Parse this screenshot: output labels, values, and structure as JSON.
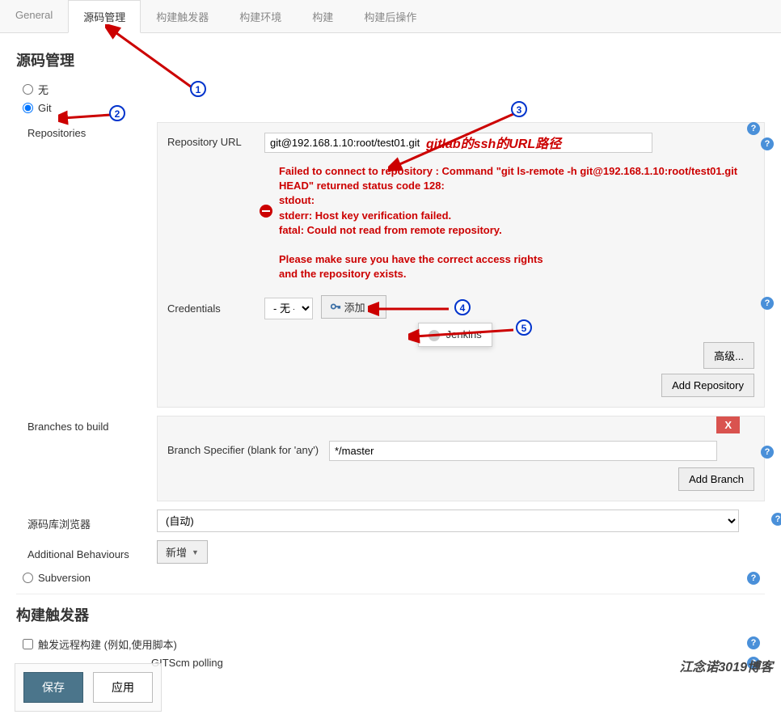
{
  "tabs": {
    "general": "General",
    "scm": "源码管理",
    "triggers": "构建触发器",
    "env": "构建环境",
    "build": "构建",
    "post": "构建后操作"
  },
  "section_scm_title": "源码管理",
  "radio_none": "无",
  "radio_git": "Git",
  "radio_svn": "Subversion",
  "repositories_label": "Repositories",
  "repo_url_label": "Repository URL",
  "repo_url_value": "git@192.168.1.10:root/test01.git",
  "repo_url_annotation": "gitlab的ssh的URL路径",
  "error_text": "Failed to connect to repository : Command \"git ls-remote -h git@192.168.1.10:root/test01.git HEAD\" returned status code 128:\nstdout:\nstderr: Host key verification failed.\nfatal: Could not read from remote repository.\n\nPlease make sure you have the correct access rights\nand the repository exists.",
  "credentials_label": "Credentials",
  "credentials_value": "- 无 -",
  "add_button": "添加",
  "jenkins_option": "Jenkins",
  "advanced_button": "高级...",
  "add_repo_button": "Add Repository",
  "branches_label": "Branches to build",
  "branch_spec_label": "Branch Specifier (blank for 'any')",
  "branch_spec_value": "*/master",
  "delete_x": "X",
  "add_branch_button": "Add Branch",
  "browser_label": "源码库浏览器",
  "browser_value": "(自动)",
  "behaviours_label": "Additional Behaviours",
  "behaviours_button": "新增",
  "triggers_title": "构建触发器",
  "trigger_remote": "触发远程构建 (例如,使用脚本)",
  "trigger_gitscm": "GITScm polling",
  "save_button": "保存",
  "apply_button": "应用",
  "watermark": "江念诺3019博客",
  "callouts": {
    "c1": "1",
    "c2": "2",
    "c3": "3",
    "c4": "4",
    "c5": "5"
  }
}
